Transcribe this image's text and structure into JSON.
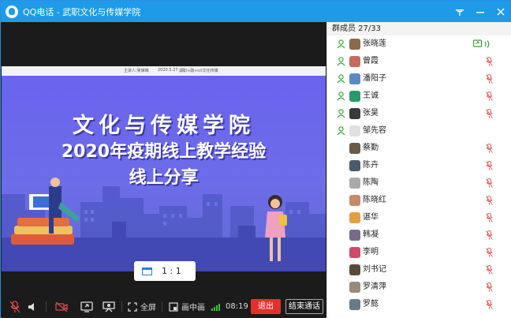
{
  "window": {
    "title": "QQ电话 - 武职文化与传媒学院"
  },
  "slide": {
    "header_left": "主讲人:吴琳琳",
    "header_mid": "2020.5.27",
    "header_right": "湖职+融+n/i文化传媒",
    "title_line1": "文化与传媒学院",
    "title_line2": "2020年疫期线上教学经验",
    "title_line3": "线上分享"
  },
  "ratio_control": {
    "label": "1 : 1"
  },
  "toolbar": {
    "fullscreen_label": "全屏",
    "pip_label": "画中画",
    "time": "08:19",
    "exit_label": "退出",
    "end_call_label": "结束通话"
  },
  "members_panel": {
    "header": "群成员 27/33",
    "members": [
      {
        "name": "张晓莲",
        "is_host": true,
        "status": "sharing",
        "avatar_color": "#8a6a4a"
      },
      {
        "name": "曾霞",
        "is_host": true,
        "status": "muted",
        "avatar_color": "#c66a5a"
      },
      {
        "name": "潘阳子",
        "is_host": true,
        "status": "muted",
        "avatar_color": "#5a8ac6"
      },
      {
        "name": "王诚",
        "is_host": true,
        "status": "muted",
        "avatar_color": "#2a9a6a"
      },
      {
        "name": "张昊",
        "is_host": true,
        "status": "muted",
        "avatar_color": "#3a3a3a"
      },
      {
        "name": "邹先容",
        "is_host": true,
        "status": "none",
        "avatar_color": "#e0e0e0"
      },
      {
        "name": "蔡勤",
        "is_host": false,
        "status": "muted",
        "avatar_color": "#6a5a4a"
      },
      {
        "name": "陈卉",
        "is_host": false,
        "status": "muted",
        "avatar_color": "#4a5a6a"
      },
      {
        "name": "陈陶",
        "is_host": false,
        "status": "muted",
        "avatar_color": "#aaaaaa"
      },
      {
        "name": "陈晓红",
        "is_host": false,
        "status": "muted",
        "avatar_color": "#c98a6a"
      },
      {
        "name": "谌华",
        "is_host": false,
        "status": "muted",
        "avatar_color": "#e0a040"
      },
      {
        "name": "韩凝",
        "is_host": false,
        "status": "muted",
        "avatar_color": "#7a6a8a"
      },
      {
        "name": "李明",
        "is_host": false,
        "status": "muted",
        "avatar_color": "#d04a6a"
      },
      {
        "name": "刘书记",
        "is_host": false,
        "status": "muted",
        "avatar_color": "#5a4a3a"
      },
      {
        "name": "罗清萍",
        "is_host": false,
        "status": "muted",
        "avatar_color": "#9a8a7a"
      },
      {
        "name": "罗懿",
        "is_host": false,
        "status": "muted",
        "avatar_color": "#6a7a8a"
      }
    ]
  },
  "colors": {
    "titlebar": "#1e9be8",
    "exit_button": "#e2312c",
    "slide_bg": "#6a63ee",
    "muted_icon": "#e06060",
    "host_icon": "#33aa33"
  }
}
